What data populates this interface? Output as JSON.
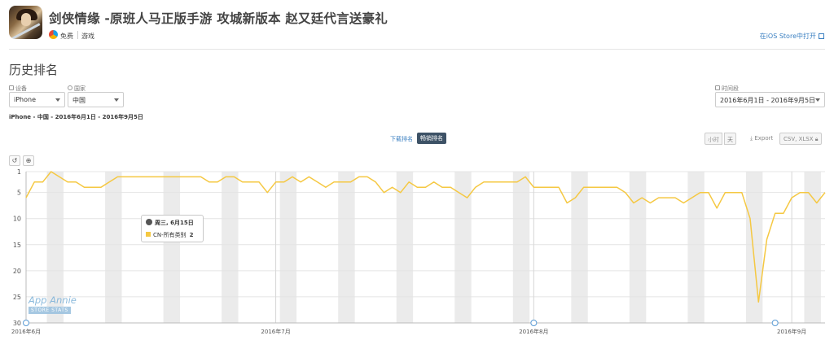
{
  "app": {
    "title": "剑侠情缘 -原班人马正版手游 攻城新版本 赵又廷代言送豪礼",
    "price": "免费",
    "genre": "游戏",
    "open_link": "在iOS Store中打开"
  },
  "section_title": "历史排名",
  "filters": {
    "device_label": "设备",
    "device_value": "iPhone",
    "country_label": "国家",
    "country_value": "中国",
    "period_label": "时间段",
    "period_value": "2016年6月1日 - 2016年9月5日"
  },
  "subtitle": "iPhone - 中国 - 2016年6月1日 - 2016年9月5日",
  "tabs": {
    "download": "下载排名",
    "sales": "畅销排名"
  },
  "toggles": {
    "hourly": "小时",
    "daily": "天"
  },
  "export": {
    "label": "Export",
    "formats": "CSV, XLSX"
  },
  "tooltip": {
    "date": "周三, 6月15日",
    "series": "CN-所有类别",
    "value": "2"
  },
  "watermark": {
    "brand": "App Annie",
    "tag": "STORE STATS"
  },
  "colors": {
    "line": "#f5c842",
    "band": "#ebebeb",
    "grid": "#e4e4e4",
    "accent": "#3a7fc1"
  },
  "icons": [
    "tencent-icon",
    "external-link-icon",
    "reset-icon",
    "zoom-icon",
    "download-icon",
    "lock-icon",
    "globe-icon",
    "device-icon"
  ],
  "chart_data": {
    "type": "line",
    "x_start": "2016-06-01",
    "x_end": "2016-09-05",
    "x_ticks": [
      "2016年6月",
      "2016年7月",
      "2016年8月",
      "2016年9月"
    ],
    "x_tick_dates": [
      "2016-06-01",
      "2016-07-01",
      "2016-08-01",
      "2016-09-01"
    ],
    "ylim": [
      1,
      30
    ],
    "y_reversed": true,
    "y_ticks": [
      1,
      5,
      10,
      15,
      20,
      25,
      30
    ],
    "grid": true,
    "weekend_bands": true,
    "annotation_marker_dates": [
      "2016-06-01",
      "2016-08-01",
      "2016-08-30"
    ],
    "series": [
      {
        "dates": [
          "2016-06-01",
          "2016-06-02",
          "2016-06-03",
          "2016-06-04",
          "2016-06-05",
          "2016-06-06",
          "2016-06-07",
          "2016-06-08",
          "2016-06-09",
          "2016-06-10",
          "2016-06-11",
          "2016-06-12",
          "2016-06-13",
          "2016-06-14",
          "2016-06-15",
          "2016-06-16",
          "2016-06-17",
          "2016-06-18",
          "2016-06-19",
          "2016-06-20",
          "2016-06-21",
          "2016-06-22",
          "2016-06-23",
          "2016-06-24",
          "2016-06-25",
          "2016-06-26",
          "2016-06-27",
          "2016-06-28",
          "2016-06-29",
          "2016-06-30",
          "2016-07-01",
          "2016-07-02",
          "2016-07-03",
          "2016-07-04",
          "2016-07-05",
          "2016-07-06",
          "2016-07-07",
          "2016-07-08",
          "2016-07-09",
          "2016-07-10",
          "2016-07-11",
          "2016-07-12",
          "2016-07-13",
          "2016-07-14",
          "2016-07-15",
          "2016-07-16",
          "2016-07-17",
          "2016-07-18",
          "2016-07-19",
          "2016-07-20",
          "2016-07-21",
          "2016-07-22",
          "2016-07-23",
          "2016-07-24",
          "2016-07-25",
          "2016-07-26",
          "2016-07-27",
          "2016-07-28",
          "2016-07-29",
          "2016-07-30",
          "2016-07-31",
          "2016-08-01",
          "2016-08-02",
          "2016-08-03",
          "2016-08-04",
          "2016-08-05",
          "2016-08-06",
          "2016-08-07",
          "2016-08-08",
          "2016-08-09",
          "2016-08-10",
          "2016-08-11",
          "2016-08-12",
          "2016-08-13",
          "2016-08-14",
          "2016-08-15",
          "2016-08-16",
          "2016-08-17",
          "2016-08-18",
          "2016-08-19",
          "2016-08-20",
          "2016-08-21",
          "2016-08-22",
          "2016-08-23",
          "2016-08-24",
          "2016-08-25",
          "2016-08-26",
          "2016-08-27",
          "2016-08-28",
          "2016-08-29",
          "2016-08-30",
          "2016-08-31",
          "2016-09-01",
          "2016-09-02",
          "2016-09-03",
          "2016-09-04",
          "2016-09-05"
        ],
        "values": [
          6,
          3,
          3,
          1,
          2,
          3,
          3,
          4,
          4,
          4,
          3,
          2,
          2,
          2,
          2,
          2,
          2,
          2,
          2,
          2,
          2,
          2,
          3,
          3,
          2,
          2,
          3,
          3,
          3,
          5,
          3,
          3,
          2,
          3,
          2,
          3,
          4,
          3,
          3,
          3,
          2,
          2,
          3,
          5,
          4,
          5,
          3,
          4,
          4,
          3,
          4,
          4,
          5,
          6,
          4,
          3,
          3,
          3,
          3,
          3,
          2,
          4,
          4,
          4,
          4,
          7,
          6,
          4,
          4,
          4,
          4,
          4,
          5,
          7,
          6,
          7,
          6,
          6,
          6,
          7,
          6,
          5,
          5,
          8,
          5,
          5,
          5,
          10,
          26,
          14,
          9,
          9,
          6,
          5,
          5,
          7,
          5
        ]
      }
    ]
  }
}
